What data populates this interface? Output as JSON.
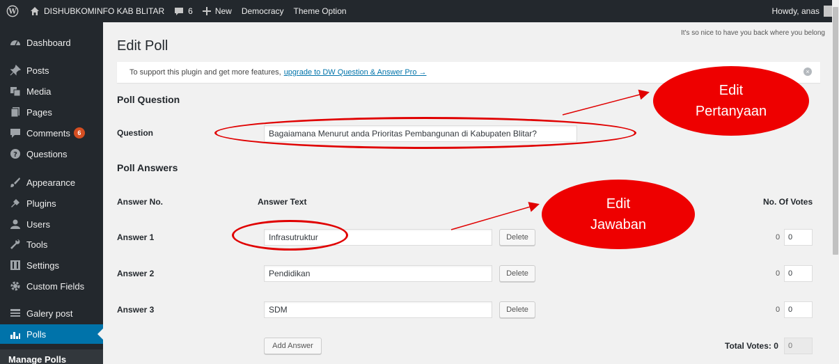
{
  "admin_bar": {
    "site_name": "DISHUBKOMINFO KAB BLITAR",
    "comments_count": "6",
    "new_label": "New",
    "link_democracy": "Democracy",
    "link_theme_option": "Theme Option",
    "howdy": "Howdy, anas"
  },
  "sidebar": {
    "items": [
      {
        "label": "Dashboard",
        "icon": "dashboard-icon"
      },
      {
        "label": "Posts",
        "icon": "pin-icon"
      },
      {
        "label": "Media",
        "icon": "media-icon"
      },
      {
        "label": "Pages",
        "icon": "pages-icon"
      },
      {
        "label": "Comments",
        "icon": "comment-icon",
        "badge": "6"
      },
      {
        "label": "Questions",
        "icon": "question-icon"
      },
      {
        "label": "Appearance",
        "icon": "brush-icon"
      },
      {
        "label": "Plugins",
        "icon": "plug-icon"
      },
      {
        "label": "Users",
        "icon": "users-icon"
      },
      {
        "label": "Tools",
        "icon": "wrench-icon"
      },
      {
        "label": "Settings",
        "icon": "settings-icon"
      },
      {
        "label": "Custom Fields",
        "icon": "gear-icon"
      },
      {
        "label": "Galery post",
        "icon": "gallery-icon"
      },
      {
        "label": "Polls",
        "icon": "poll-chart-icon"
      }
    ],
    "submenu_current": "Manage Polls"
  },
  "welcome_text": "It's so nice to have you back where you belong",
  "page_title": "Edit Poll",
  "notice": {
    "text": "To support this plugin and get more features,",
    "link": "upgrade to DW Question & Answer Pro →"
  },
  "poll_question": {
    "heading": "Poll Question",
    "label": "Question",
    "value": "Bagaiamana Menurut anda Prioritas Pembangunan di Kabupaten Blitar?"
  },
  "poll_answers": {
    "heading": "Poll Answers",
    "col_no": "Answer No.",
    "col_text": "Answer Text",
    "col_votes": "No. Of Votes",
    "rows": [
      {
        "no": "Answer 1",
        "text": "Infrasutruktur",
        "delete": "Delete",
        "votes_text": "0",
        "votes_value": "0"
      },
      {
        "no": "Answer 2",
        "text": "Pendidikan",
        "delete": "Delete",
        "votes_text": "0",
        "votes_value": "0"
      },
      {
        "no": "Answer 3",
        "text": "SDM",
        "delete": "Delete",
        "votes_text": "0",
        "votes_value": "0"
      }
    ],
    "add_answer": "Add Answer",
    "total_votes_label": "Total Votes: 0",
    "total_votes_value": "0"
  },
  "annotations": {
    "bubble_question": [
      "Edit",
      "Pertanyaan"
    ],
    "bubble_answer": [
      "Edit",
      "Jawaban"
    ],
    "color": "#ee0000"
  },
  "colors": {
    "admin_bar": "#23282d",
    "sidebar": "#23282d",
    "current_menu": "#0073aa",
    "link": "#0073aa",
    "badge": "#d54e21"
  }
}
